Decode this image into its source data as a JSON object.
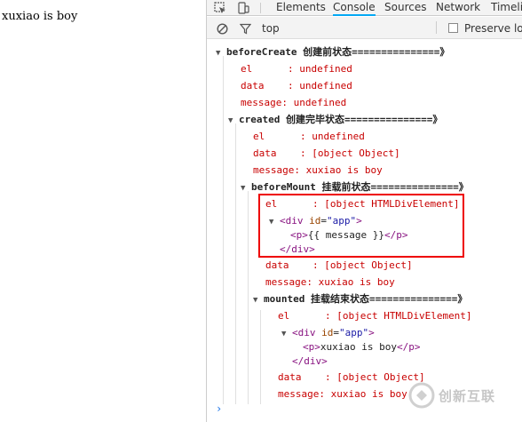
{
  "page": {
    "text": "xuxiao is boy"
  },
  "devtools": {
    "tabs": [
      "Elements",
      "Console",
      "Sources",
      "Network",
      "Timelir"
    ],
    "active_tab": "Console",
    "context": "top",
    "preserve_log": "Preserve log",
    "accent": "#03a9f4"
  },
  "console": {
    "groups": [
      {
        "title": "beforeCreate 创建前状态===============》",
        "rows": [
          {
            "k": "el      : ",
            "v": "undefined"
          },
          {
            "k": "data    : ",
            "v": "undefined"
          },
          {
            "k": "message: ",
            "v": "undefined"
          }
        ]
      },
      {
        "title": "created 创建完毕状态===============》",
        "rows": [
          {
            "k": "el      : ",
            "v": "undefined"
          },
          {
            "k": "data    : ",
            "v": "[object Object]"
          },
          {
            "k": "message: ",
            "v": "xuxiao is boy"
          }
        ]
      },
      {
        "title": "beforeMount 挂载前状态===============》",
        "rows": [
          {
            "k": "el      : ",
            "v": "[object HTMLDivElement]"
          },
          {
            "k": "data    : ",
            "v": "[object Object]"
          },
          {
            "k": "message: ",
            "v": "xuxiao is boy"
          }
        ],
        "dom": {
          "open": "div",
          "id_attr": "id",
          "id_val": "\"app\"",
          "inner": "{{ message }}",
          "close": "div"
        }
      },
      {
        "title": "mounted 挂载结束状态===============》",
        "rows": [
          {
            "k": "el      : ",
            "v": "[object HTMLDivElement]"
          },
          {
            "k": "data    : ",
            "v": "[object Object]"
          },
          {
            "k": "message: ",
            "v": "xuxiao is boy"
          }
        ],
        "dom": {
          "open": "div",
          "id_attr": "id",
          "id_val": "\"app\"",
          "inner": "xuxiao is boy",
          "close": "div"
        }
      }
    ],
    "prompt": "›"
  },
  "watermark": {
    "text": "创新互联"
  }
}
